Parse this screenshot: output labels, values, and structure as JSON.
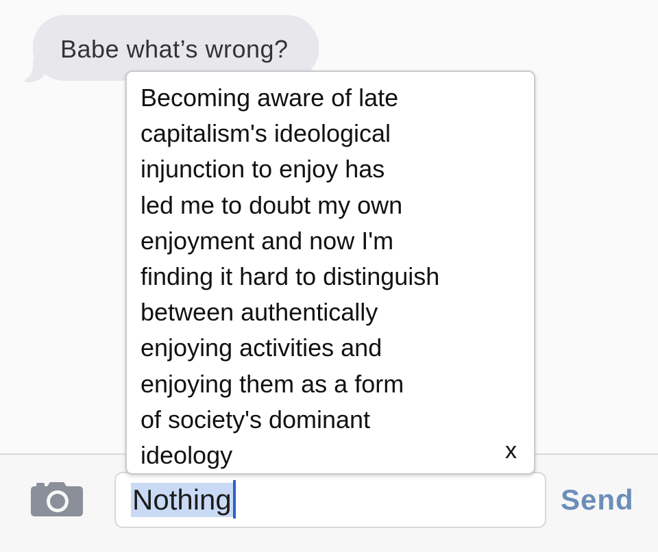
{
  "conversation": {
    "incoming_message": "Babe what’s wrong?"
  },
  "autocorrect_suggestion": {
    "text": "Becoming aware of late\ncapitalism's ideological\ninjunction to enjoy has\nled me to doubt my own\nenjoyment and now I'm\nfinding it hard to distinguish\nbetween authentically\nenjoying activities and\nenjoying them as a form\nof society's dominant\nideology",
    "dismiss_label": "x"
  },
  "input_bar": {
    "camera_icon": "camera-icon",
    "input_value": "Nothing",
    "send_label": "Send"
  },
  "colors": {
    "incoming_bubble": "#e7e7ec",
    "send_button": "#6b8eb8",
    "text_selection": "#c9daf5",
    "caret": "#2e5fc8"
  }
}
